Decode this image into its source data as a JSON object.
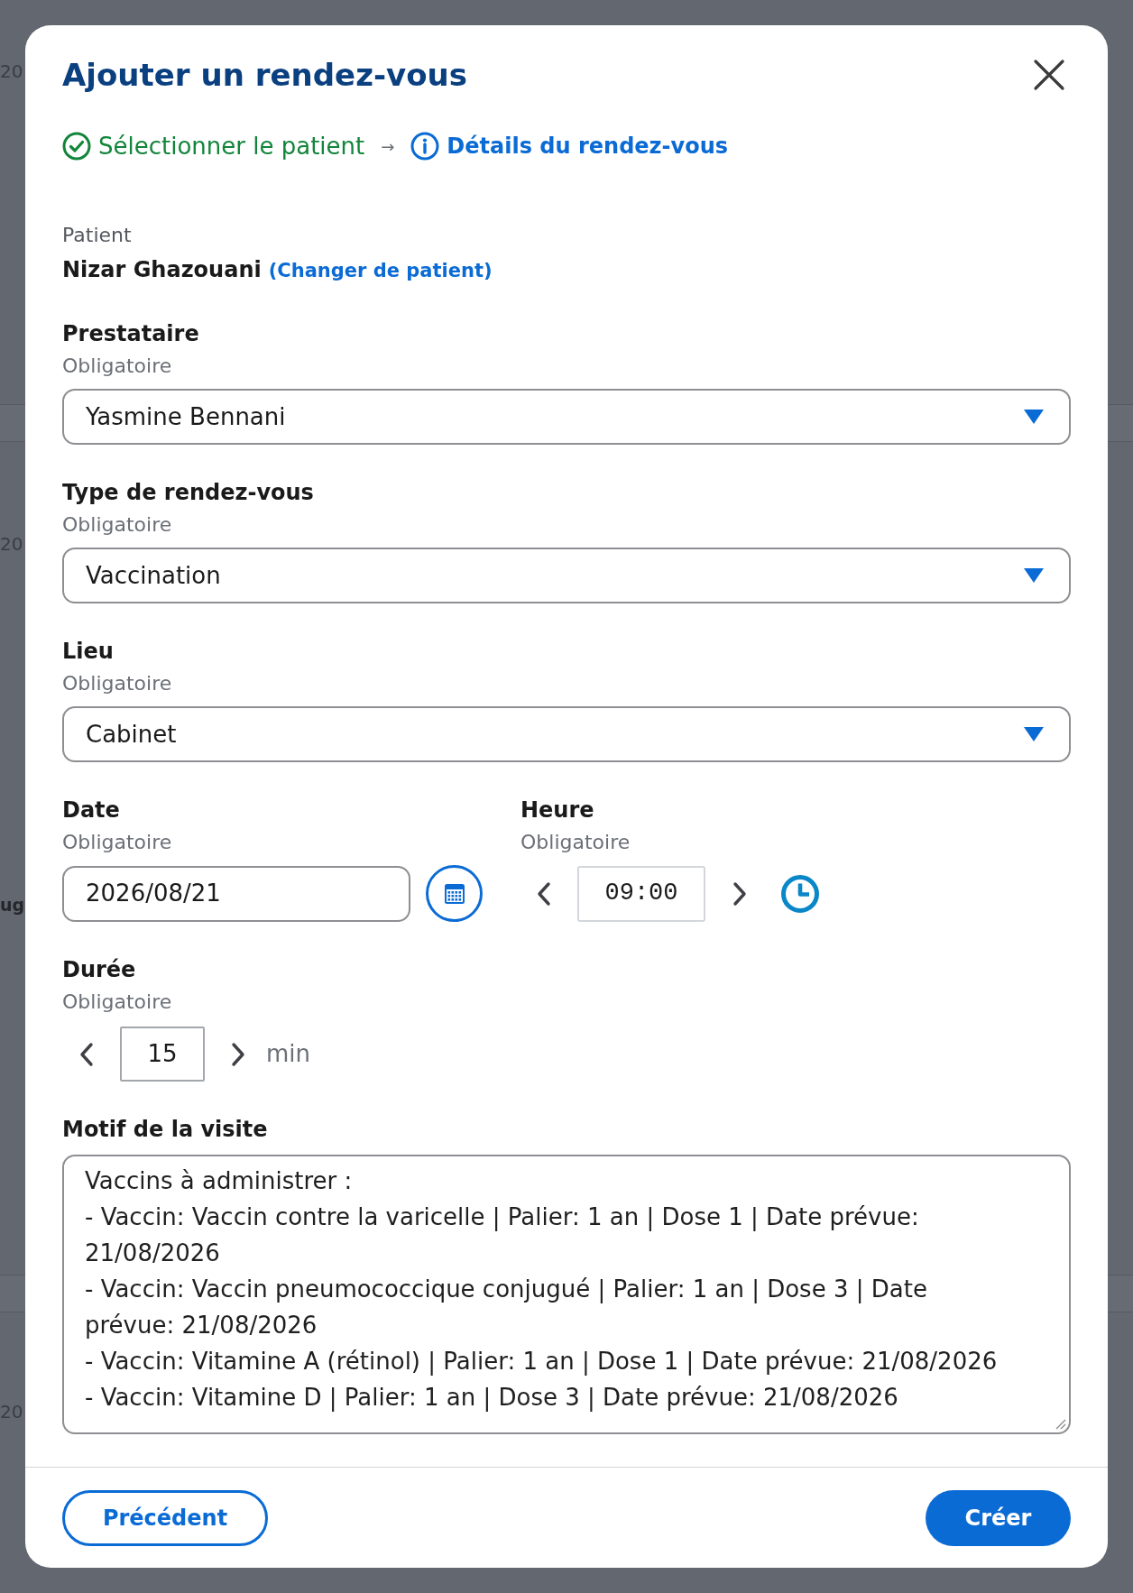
{
  "background": {
    "texts": [
      {
        "text": "20",
        "kind": "plain"
      },
      {
        "text": "20",
        "kind": "plain"
      },
      {
        "text": "ug",
        "kind": "strong"
      },
      {
        "text": "20",
        "kind": "plain"
      }
    ]
  },
  "dialog": {
    "title": "Ajouter un rendez-vous"
  },
  "steps": {
    "items": [
      {
        "label": "Sélectionner le patient",
        "completed": true,
        "selected": false
      },
      {
        "label": "Détails du rendez-vous",
        "completed": false,
        "selected": true
      }
    ],
    "separator": "→"
  },
  "patient": {
    "label": "Patient",
    "name": "Nizar Ghazouani",
    "change_link": "(Changer de patient)"
  },
  "fields": [
    {
      "kind": "select",
      "label": "Prestataire",
      "note": "Obligatoire",
      "value": "Yasmine Bennani"
    },
    {
      "kind": "select",
      "label": "Type de rendez-vous",
      "note": "Obligatoire",
      "value": "Vaccination"
    },
    {
      "kind": "select",
      "label": "Lieu",
      "note": "Obligatoire",
      "value": "Cabinet"
    },
    {
      "kind": "row",
      "items": [
        {
          "kind": "date",
          "label": "Date",
          "note": "Obligatoire",
          "value": "2026/08/21"
        },
        {
          "kind": "time",
          "label": "Heure",
          "note": "Obligatoire",
          "value": "09:00"
        }
      ]
    },
    {
      "kind": "stepper",
      "label": "Durée",
      "note": "Obligatoire",
      "value": "15",
      "unit": "min"
    },
    {
      "kind": "textarea",
      "label": "Motif de la visite",
      "value": "Vaccins à administrer :\n- Vaccin: Vaccin contre la varicelle | Palier: 1 an | Dose 1 | Date prévue: 21/08/2026\n- Vaccin: Vaccin pneumococcique conjugué | Palier: 1 an | Dose 3 | Date prévue: 21/08/2026\n- Vaccin: Vitamine A (rétinol) | Palier: 1 an | Dose 1 | Date prévue: 21/08/2026\n- Vaccin: Vitamine D | Palier: 1 an | Dose 3 | Date prévue: 21/08/2026"
    }
  ],
  "footer": {
    "buttons": [
      {
        "label": "Précédent",
        "kind": "secondary"
      },
      {
        "label": "Créer",
        "kind": "primary"
      }
    ]
  }
}
